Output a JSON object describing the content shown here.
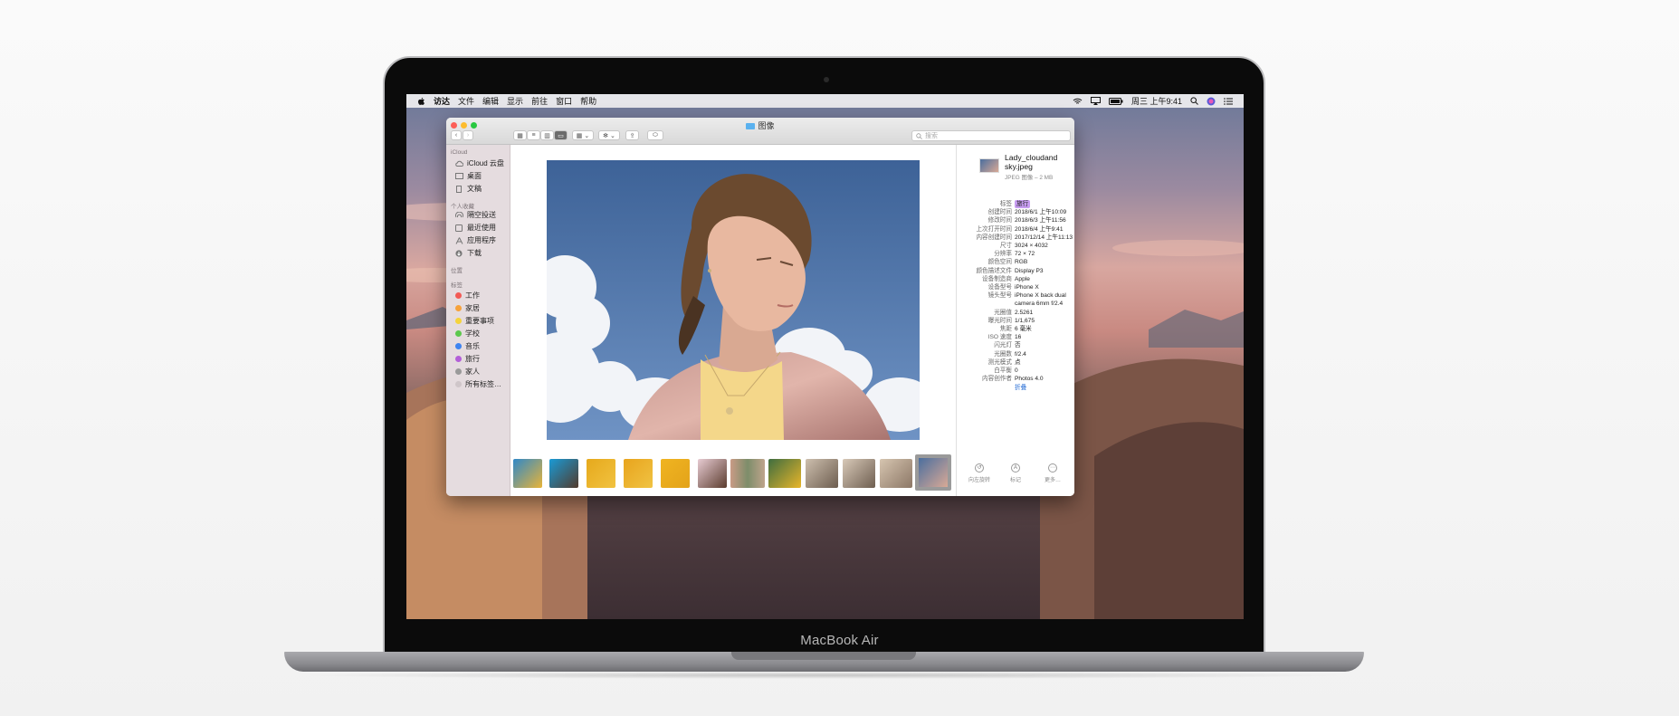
{
  "brand": "MacBook Air",
  "menubar": {
    "apple_icon": "apple-icon",
    "items": [
      "访达",
      "文件",
      "编辑",
      "显示",
      "前往",
      "窗口",
      "帮助"
    ],
    "clock": "周三 上午9:41",
    "status_icons": [
      "wifi-icon",
      "airplay-icon",
      "battery-icon",
      "search-icon",
      "siri-icon",
      "notification-center-icon"
    ]
  },
  "window": {
    "title": "图像",
    "search_placeholder": "搜索",
    "traffic_light_colors": [
      "#fc5f57",
      "#fdbc2e",
      "#28c840"
    ]
  },
  "sidebar": {
    "sections": {
      "icloud": "iCloud",
      "favorites": "个人收藏",
      "locations": "位置",
      "tags": "标签"
    },
    "icloud_items": [
      {
        "label": "iCloud 云盘",
        "icon": "cloud-icon"
      },
      {
        "label": "桌面",
        "icon": "desktop-icon"
      },
      {
        "label": "文稿",
        "icon": "document-icon"
      }
    ],
    "favorite_items": [
      {
        "label": "隔空投送",
        "icon": "airdrop-icon"
      },
      {
        "label": "最近使用",
        "icon": "clock-icon"
      },
      {
        "label": "应用程序",
        "icon": "applications-icon"
      },
      {
        "label": "下载",
        "icon": "download-icon"
      }
    ],
    "tag_items": [
      {
        "label": "工作",
        "color": "#f25a55"
      },
      {
        "label": "家居",
        "color": "#f7a23b"
      },
      {
        "label": "重要事项",
        "color": "#f5d33c"
      },
      {
        "label": "学校",
        "color": "#5cc84d"
      },
      {
        "label": "音乐",
        "color": "#3f84f0"
      },
      {
        "label": "旅行",
        "color": "#b35fd8"
      },
      {
        "label": "家人",
        "color": "#9a9a9a"
      },
      {
        "label": "所有标签…",
        "color": "#cfc6c9"
      }
    ]
  },
  "inspector": {
    "file_name": "Lady_cloudand sky.jpeg",
    "file_sub": "JPEG 图像 – 2 MB",
    "metadata": [
      {
        "k": "标签",
        "v": "旅行"
      },
      {
        "k": "创建时间",
        "v": "2018/6/1 上午10:09"
      },
      {
        "k": "修改时间",
        "v": "2018/6/3 上午11:56"
      },
      {
        "k": "上次打开时间",
        "v": "2018/6/4 上午9:41"
      },
      {
        "k": "内容创建时间",
        "v": "2017/12/14 上午11:13"
      },
      {
        "k": "尺寸",
        "v": "3024 × 4032"
      },
      {
        "k": "分辨率",
        "v": "72 × 72"
      },
      {
        "k": "颜色空间",
        "v": "RGB"
      },
      {
        "k": "颜色描述文件",
        "v": "Display P3"
      },
      {
        "k": "设备制造商",
        "v": "Apple"
      },
      {
        "k": "设备型号",
        "v": "iPhone X"
      },
      {
        "k": "镜头型号",
        "v": "iPhone X back dual"
      },
      {
        "k": "",
        "v": "camera 6mm f/2.4"
      },
      {
        "k": "光圈值",
        "v": "2.5261"
      },
      {
        "k": "曝光时间",
        "v": "1/1,675"
      },
      {
        "k": "焦距",
        "v": "6 毫米"
      },
      {
        "k": "ISO 速度",
        "v": "16"
      },
      {
        "k": "闪光灯",
        "v": "否"
      },
      {
        "k": "光圈数",
        "v": "f/2.4"
      },
      {
        "k": "测光模式",
        "v": "点"
      },
      {
        "k": "白平衡",
        "v": "0"
      },
      {
        "k": "内容创作者",
        "v": "Photos 4.0"
      }
    ],
    "fold_link": "折叠",
    "actions": [
      {
        "label": "向左旋转",
        "icon": "rotate-left-icon"
      },
      {
        "label": "标记",
        "icon": "markup-icon"
      },
      {
        "label": "更多…",
        "icon": "more-icon"
      }
    ]
  }
}
